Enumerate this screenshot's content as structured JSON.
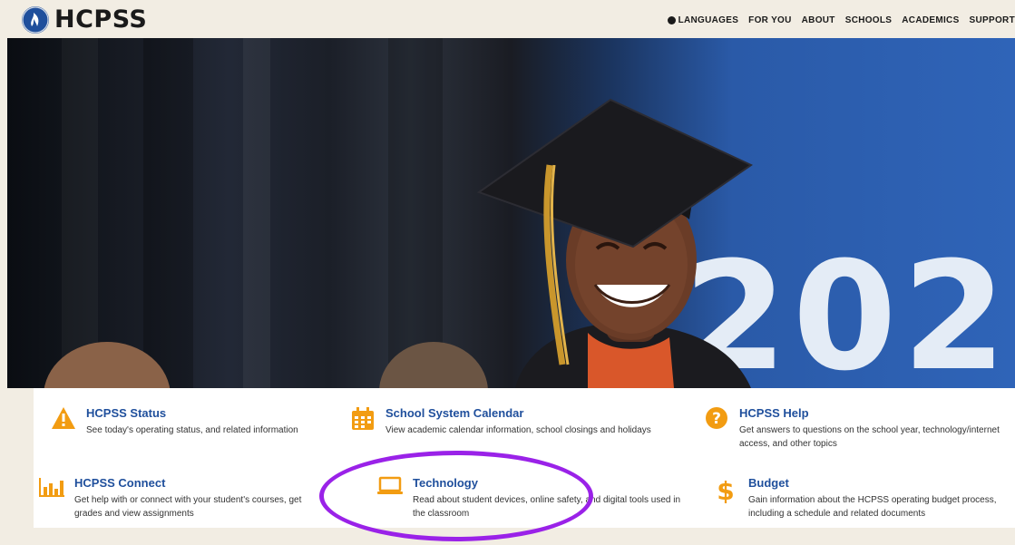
{
  "header": {
    "logo_text": "HCPSS",
    "nav": [
      {
        "label": "LANGUAGES",
        "icon": "globe-icon"
      },
      {
        "label": "FOR YOU"
      },
      {
        "label": "ABOUT"
      },
      {
        "label": "SCHOOLS"
      },
      {
        "label": "ACADEMICS"
      },
      {
        "label": "SUPPORT"
      }
    ]
  },
  "hero": {
    "banner_digits": "202"
  },
  "cards": [
    {
      "title": "HCPSS Status",
      "desc": "See today's operating status, and related information",
      "icon": "warning-icon"
    },
    {
      "title": "School System Calendar",
      "desc": "View academic calendar information, school closings and holidays",
      "icon": "calendar-icon"
    },
    {
      "title": "HCPSS Help",
      "desc": "Get answers to questions on the school year, technology/internet access, and other topics",
      "icon": "help-icon"
    },
    {
      "title": "HCPSS Connect",
      "desc": "Get help with or connect with your student's courses, get grades and view assignments",
      "icon": "bar-chart-icon"
    },
    {
      "title": "Technology",
      "desc": "Read about student devices, online safety, and digital tools used in the classroom",
      "icon": "laptop-icon"
    },
    {
      "title": "Budget",
      "desc": "Gain information about the HCPSS operating budget process, including a schedule and related documents",
      "icon": "dollar-icon"
    }
  ],
  "colors": {
    "accent": "#f29c12",
    "link": "#1f4f9c",
    "highlight": "#9a22e8",
    "page_bg": "#f2ede3"
  }
}
